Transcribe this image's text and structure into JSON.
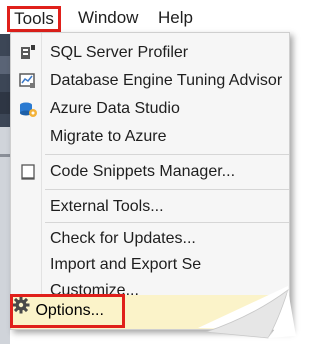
{
  "menubar": {
    "items": [
      {
        "label": "Tools",
        "highlighted": true
      },
      {
        "label": "Window"
      },
      {
        "label": "Help"
      }
    ]
  },
  "menu": {
    "items": [
      {
        "label": "SQL Server Profiler",
        "icon": "profiler-icon"
      },
      {
        "label": "Database Engine Tuning Advisor",
        "icon": "tuning-advisor-icon"
      },
      {
        "label": "Azure Data Studio",
        "icon": "azure-data-studio-icon"
      },
      {
        "label": "Migrate to Azure",
        "icon": ""
      },
      {
        "label": "Code Snippets Manager...",
        "icon": "snippets-icon"
      },
      {
        "label": "External Tools...",
        "icon": ""
      },
      {
        "label": "Check for Updates...",
        "icon": ""
      },
      {
        "label": "Import and Export Se",
        "icon": ""
      },
      {
        "label": "Customize...",
        "icon": ""
      },
      {
        "label": "Options...",
        "icon": "gear-icon",
        "highlighted": true
      }
    ]
  },
  "colors": {
    "highlight_border": "#e0201b",
    "hover_background": "#fbf3c9",
    "menu_background": "#f6f6f6"
  }
}
